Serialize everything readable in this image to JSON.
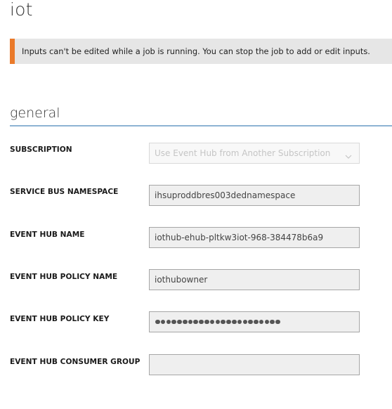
{
  "page": {
    "title": "iot"
  },
  "notice": {
    "message": "Inputs can't be edited while a job is running. You can stop the job to add or edit inputs.",
    "accent_color": "#ea7a2a"
  },
  "section": {
    "title": "general",
    "rule_color": "#8db3d3"
  },
  "fields": {
    "subscription": {
      "label": "SUBSCRIPTION",
      "value": "Use Event Hub from Another Subscription",
      "icon": "chevron-down-icon",
      "disabled": true
    },
    "service_bus_namespace": {
      "label": "SERVICE BUS NAMESPACE",
      "value": "ihsuproddbres003dednamespace"
    },
    "event_hub_name": {
      "label": "EVENT HUB NAME",
      "value": "iothub-ehub-pltkw3iot-968-384478b6a9"
    },
    "event_hub_policy_name": {
      "label": "EVENT HUB POLICY NAME",
      "value": "iothubowner"
    },
    "event_hub_policy_key": {
      "label": "EVENT HUB POLICY KEY",
      "masked_length": 23
    },
    "event_hub_consumer_group": {
      "label": "EVENT HUB CONSUMER GROUP",
      "value": ""
    }
  }
}
